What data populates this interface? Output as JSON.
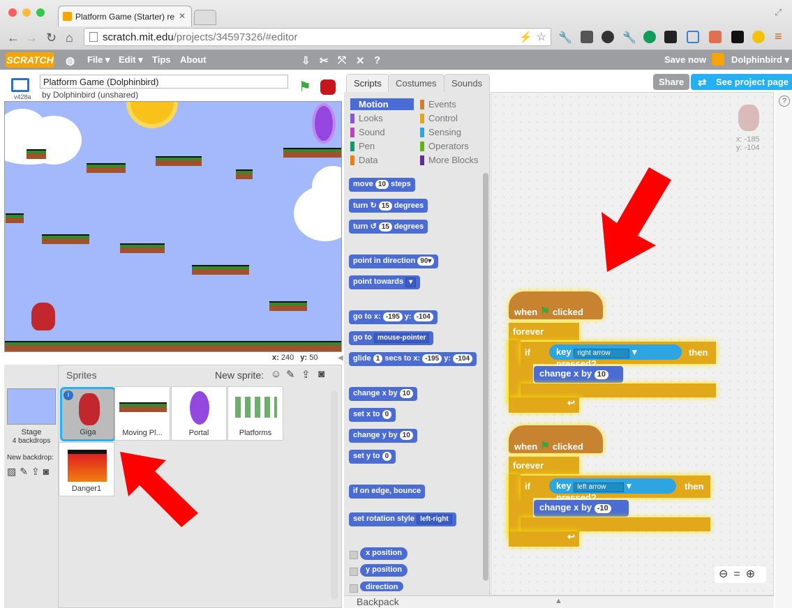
{
  "browser": {
    "tab_title": "Platform Game (Starter) re",
    "url_host": "scratch.mit.edu",
    "url_path": "/projects/34597326/#editor"
  },
  "menubar": {
    "logo": "SCRATCH",
    "items": [
      "File ▾",
      "Edit ▾",
      "Tips",
      "About"
    ],
    "save_now": "Save now",
    "user": "Dolphinbird ▾"
  },
  "stage": {
    "version": "v428a",
    "project_title": "Platform Game (Dolphinbird)",
    "byline": "by Dolphinbird (unshared)",
    "x_label": "x:",
    "x_value": "240",
    "y_label": "y:",
    "y_value": "50"
  },
  "sprites": {
    "header": "Sprites",
    "new_sprite": "New sprite:",
    "stage_label": "Stage",
    "backdrops": "4 backdrops",
    "new_backdrop": "New backdrop:",
    "items": [
      "Giga",
      "Moving Pl...",
      "Portal",
      "Platforms",
      "Danger1"
    ]
  },
  "editor_tabs": [
    "Scripts",
    "Costumes",
    "Sounds"
  ],
  "buttons": {
    "share": "Share",
    "see_project": "See project page"
  },
  "categories": [
    {
      "label": "Motion",
      "color": "#4a6cd4"
    },
    {
      "label": "Events",
      "color": "#c88330"
    },
    {
      "label": "Looks",
      "color": "#8a55d7"
    },
    {
      "label": "Control",
      "color": "#e1a91a"
    },
    {
      "label": "Sound",
      "color": "#bb42c3"
    },
    {
      "label": "Sensing",
      "color": "#2ca5e2"
    },
    {
      "label": "Pen",
      "color": "#0e9a6c"
    },
    {
      "label": "Operators",
      "color": "#5cb712"
    },
    {
      "label": "Data",
      "color": "#ee7d16"
    },
    {
      "label": "More Blocks",
      "color": "#632d99"
    }
  ],
  "palette": {
    "move": "move",
    "move_n": "10",
    "steps": "steps",
    "turn": "turn",
    "turn_n": "15",
    "degrees": "degrees",
    "point_dir": "point in direction",
    "point_dir_n": "90▾",
    "point_towards": "point towards",
    "goto_xy": "go to x:",
    "goto_x": "-195",
    "y_lbl": "y:",
    "goto_y": "-104",
    "goto": "go to",
    "goto_target": "mouse-pointer",
    "glide": "glide",
    "glide_n": "1",
    "secs_to_x": "secs to x:",
    "glide_x": "-195",
    "glide_y": "-104",
    "change_x": "change x by",
    "change_x_n": "10",
    "set_x": "set x to",
    "set_x_n": "0",
    "change_y": "change y by",
    "change_y_n": "10",
    "set_y": "set y to",
    "set_y_n": "0",
    "bounce": "if on edge, bounce",
    "rot_style": "set rotation style",
    "rot_style_v": "left-right",
    "x_pos": "x position",
    "y_pos": "y position",
    "direction": "direction"
  },
  "backpack": "Backpack",
  "sprite_info": {
    "x": "x: -185",
    "y": "y: -104"
  },
  "scripts": [
    {
      "when": "when",
      "clicked": "clicked",
      "forever": "forever",
      "if": "if",
      "key": "key",
      "key_val": "right arrow",
      "pressed": "pressed?",
      "then": "then",
      "change": "change x by",
      "value": "10"
    },
    {
      "when": "when",
      "clicked": "clicked",
      "forever": "forever",
      "if": "if",
      "key": "key",
      "key_val": "left arrow",
      "pressed": "pressed?",
      "then": "then",
      "change": "change x by",
      "value": "-10"
    }
  ]
}
